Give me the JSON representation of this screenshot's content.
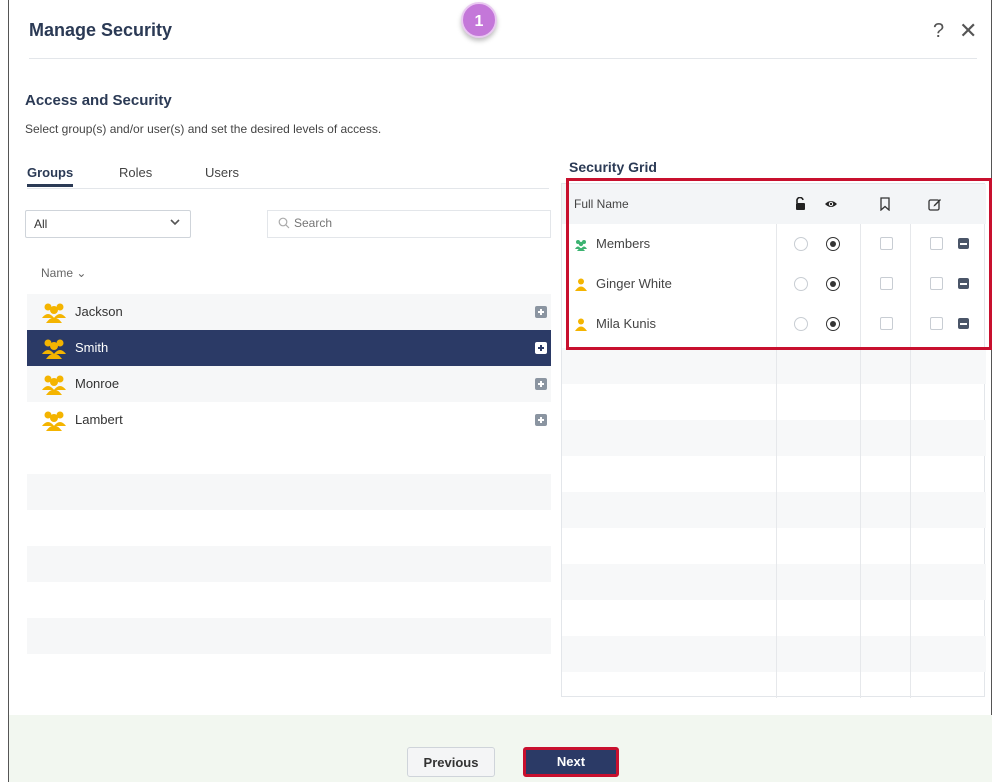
{
  "dialog": {
    "title": "Manage Security",
    "step_badge": "1",
    "help_label": "?",
    "close_label": "✕"
  },
  "section": {
    "title": "Access and Security",
    "description": "Select group(s) and/or user(s) and set the desired levels of access."
  },
  "tabs": [
    {
      "label": "Groups",
      "active": true
    },
    {
      "label": "Roles",
      "active": false
    },
    {
      "label": "Users",
      "active": false
    }
  ],
  "filter": {
    "selected": "All"
  },
  "search": {
    "placeholder": "Search"
  },
  "list": {
    "column_header": "Name ⌄",
    "rows": [
      {
        "label": "Jackson",
        "selected": false
      },
      {
        "label": "Smith",
        "selected": true
      },
      {
        "label": "Monroe",
        "selected": false
      },
      {
        "label": "Lambert",
        "selected": false
      }
    ]
  },
  "security_grid": {
    "title": "Security Grid",
    "column_header": "Full Name",
    "header_icons": [
      "lock-open-icon",
      "eye-icon",
      "bookmark-icon",
      "edit-icon"
    ],
    "rows": [
      {
        "name": "Members",
        "icon": "group-icon",
        "access": "view"
      },
      {
        "name": "Ginger White",
        "icon": "user-icon",
        "access": "view"
      },
      {
        "name": "Mila Kunis",
        "icon": "user-icon",
        "access": "view"
      }
    ]
  },
  "footer": {
    "previous_label": "Previous",
    "next_label": "Next"
  },
  "colors": {
    "navy": "#2b3a66",
    "highlight_red": "#c8102e",
    "badge_purple": "#c477d9",
    "group_yellow": "#f4b400",
    "members_green": "#3cb371"
  }
}
